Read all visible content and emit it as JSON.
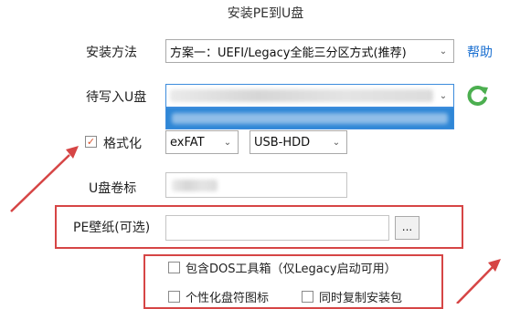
{
  "window": {
    "title": "安装PE到U盘"
  },
  "install_method": {
    "label": "安装方法",
    "selected": "方案一：UEFI/Legacy全能三分区方式(推荐)",
    "help": "帮助"
  },
  "target_disk": {
    "label": "待写入U盘"
  },
  "format": {
    "label": "格式化",
    "checked": true,
    "fs_selected": "exFAT",
    "mode_selected": "USB-HDD"
  },
  "volume_label": {
    "label": "U盘卷标"
  },
  "wallpaper": {
    "label": "PE壁纸(可选)",
    "browse_label": "..."
  },
  "options": {
    "dos_tools": "包含DOS工具箱（仅Legacy启动可用）",
    "custom_icon": "个性化盘符图标",
    "copy_installer": "同时复制安装包"
  },
  "colors": {
    "help_link": "#1a6fd0",
    "annotation_red": "#d64545",
    "refresh_green": "#4caf50"
  }
}
